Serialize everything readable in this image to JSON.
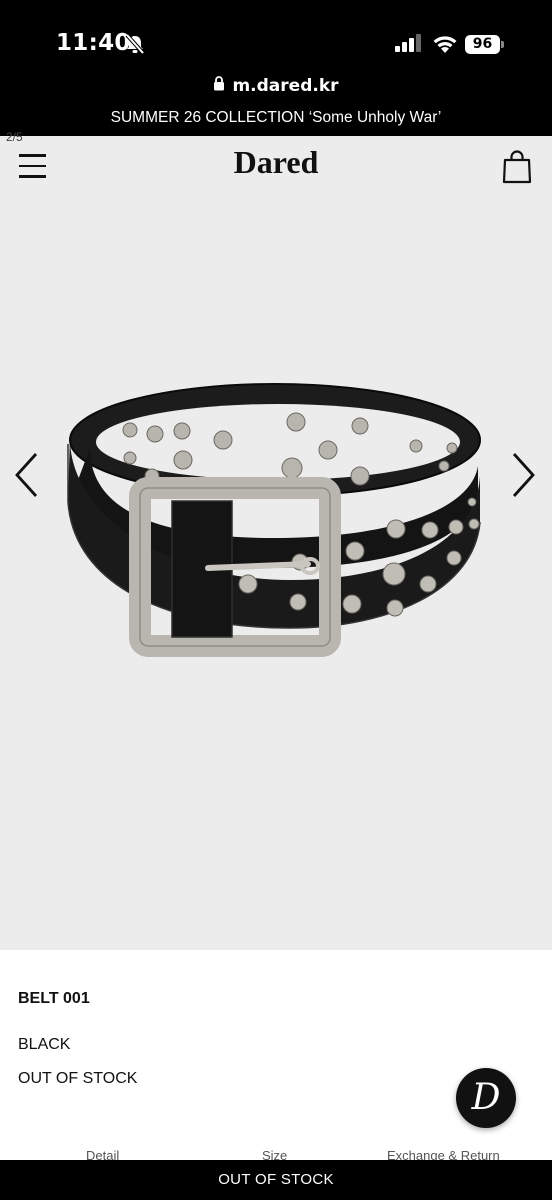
{
  "status_bar": {
    "time": "11:40",
    "battery": "96",
    "icons": [
      "bell-slash-icon",
      "signal-icon",
      "wifi-icon",
      "battery-icon"
    ]
  },
  "browser": {
    "url": "m.dared.kr",
    "lock_icon": "lock-icon"
  },
  "announcement": "SUMMER 26 COLLECTION ‘Some Unholy War’",
  "header": {
    "logo": "Dared",
    "menu_icon": "hamburger-menu-icon",
    "cart_icon": "shopping-bag-icon"
  },
  "gallery": {
    "counter": "2/5",
    "current_slide": 2,
    "total_slides": 5,
    "image_alt": "black studded leather belt with silver square buckle",
    "prev_icon": "chevron-left-icon",
    "next_icon": "chevron-right-icon"
  },
  "product": {
    "name": "BELT 001",
    "color": "BLACK",
    "stock_status": "OUT OF STOCK"
  },
  "tabs": [
    {
      "label": "Detail"
    },
    {
      "label": "Size"
    },
    {
      "label": "Exchange & Return"
    }
  ],
  "floating_button": {
    "letter": "D",
    "icon": "brand-d-logo-icon"
  },
  "cta": {
    "label": "OUT OF STOCK"
  },
  "colors": {
    "bar_background": "#000000",
    "gallery_background": "#ececec",
    "text": "#111111"
  }
}
